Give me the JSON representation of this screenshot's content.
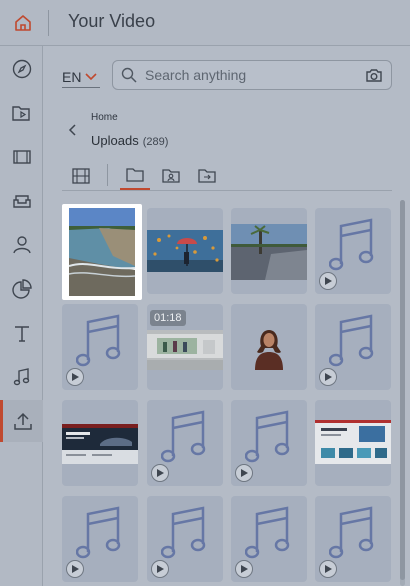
{
  "app": {
    "title": "Your Video",
    "brand_color": "#c0492f"
  },
  "rail": {
    "items": [
      {
        "name": "compass-icon",
        "active": false
      },
      {
        "name": "media-folder-icon",
        "active": false
      },
      {
        "name": "film-icon",
        "active": false
      },
      {
        "name": "sofa-icon",
        "active": false
      },
      {
        "name": "person-icon",
        "active": false
      },
      {
        "name": "pie-chart-icon",
        "active": false
      },
      {
        "name": "text-icon",
        "active": false
      },
      {
        "name": "music-note-icon",
        "active": false
      },
      {
        "name": "upload-icon",
        "active": true
      }
    ]
  },
  "language": {
    "value": "EN"
  },
  "search": {
    "placeholder": "Search anything"
  },
  "breadcrumb": {
    "parent": "Home"
  },
  "folder": {
    "title": "Uploads",
    "count": "(289)"
  },
  "tabs": [
    {
      "name": "grid-view-icon",
      "active": false
    },
    {
      "name": "folder-icon",
      "active": true
    },
    {
      "name": "user-folder-icon",
      "active": false
    },
    {
      "name": "import-icon",
      "active": false
    }
  ],
  "media": [
    {
      "kind": "image",
      "subject": "beach-cliffs",
      "selected": true
    },
    {
      "kind": "image",
      "subject": "person-with-umbrella-and-birds"
    },
    {
      "kind": "image",
      "subject": "parking-lot-palm-tree"
    },
    {
      "kind": "audio"
    },
    {
      "kind": "audio"
    },
    {
      "kind": "video",
      "duration": "01:18",
      "subject": "people-in-room"
    },
    {
      "kind": "image",
      "subject": "woman-portrait"
    },
    {
      "kind": "audio"
    },
    {
      "kind": "image",
      "subject": "website-car-banner"
    },
    {
      "kind": "audio"
    },
    {
      "kind": "audio"
    },
    {
      "kind": "image",
      "subject": "website-screenshot"
    },
    {
      "kind": "audio"
    },
    {
      "kind": "audio"
    },
    {
      "kind": "audio"
    },
    {
      "kind": "audio"
    }
  ]
}
